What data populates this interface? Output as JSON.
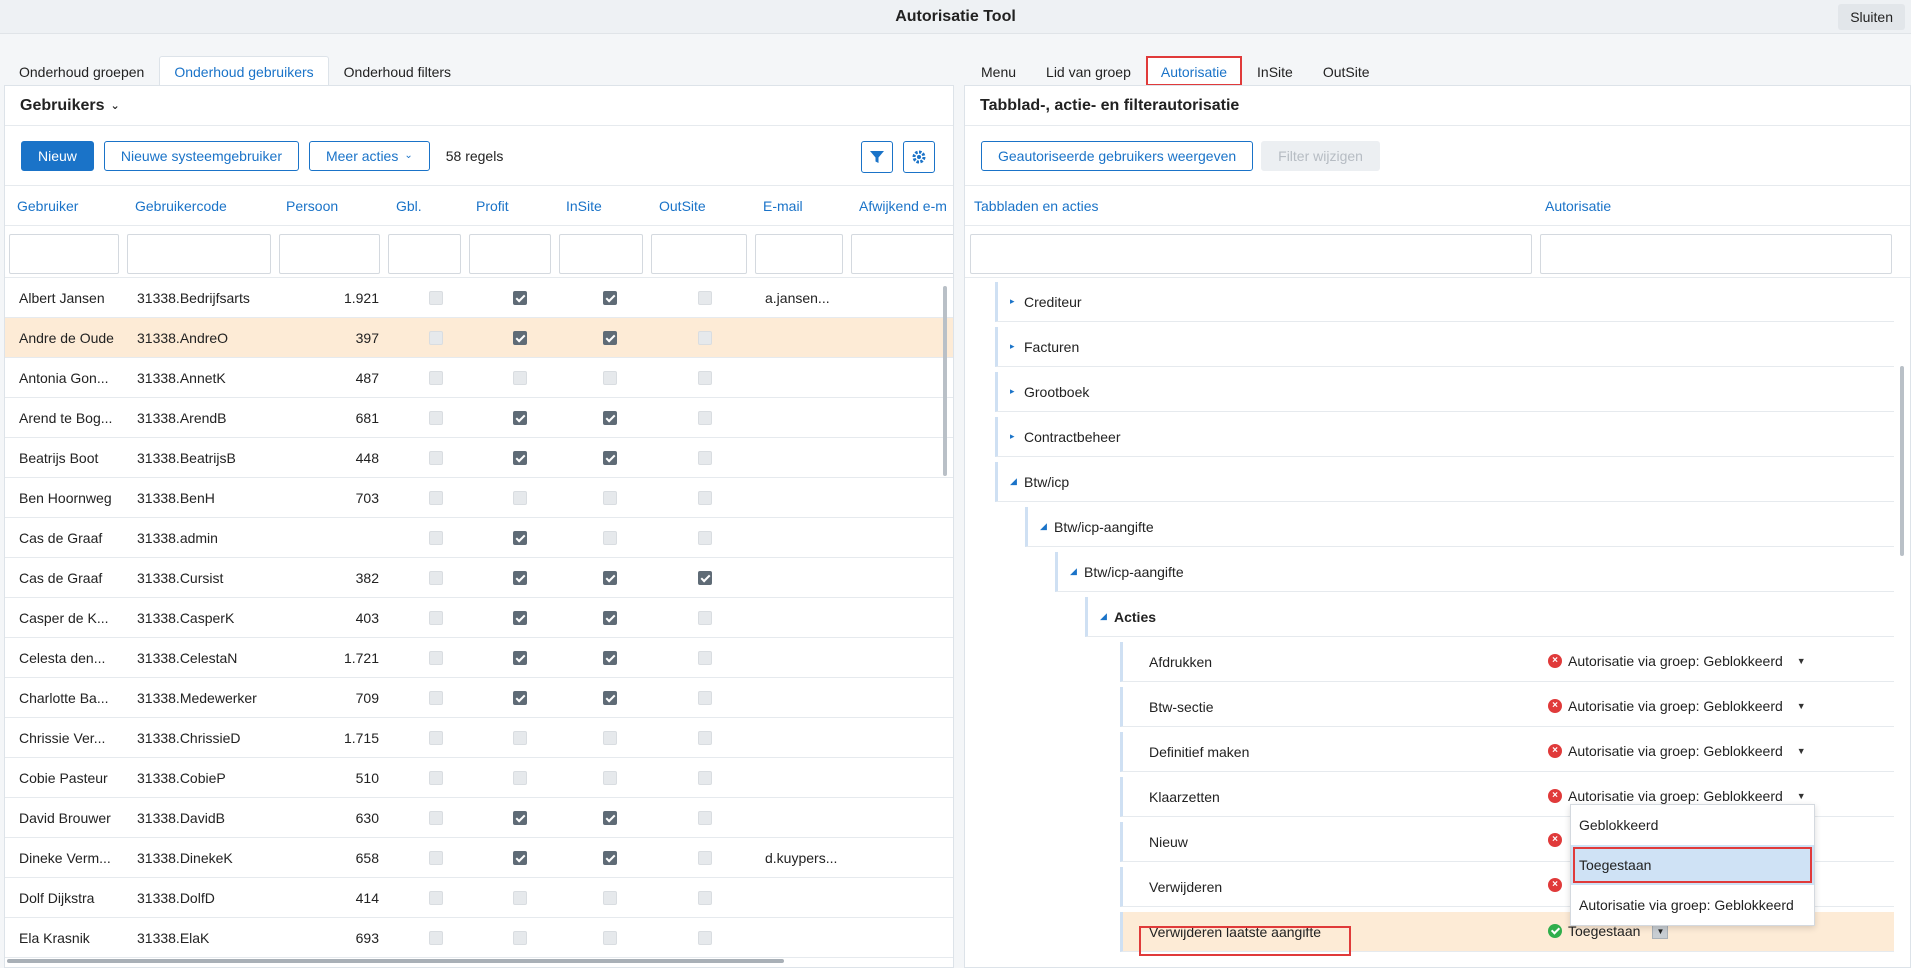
{
  "app": {
    "title": "Autorisatie Tool",
    "close_label": "Sluiten"
  },
  "left_tabs": [
    "Onderhoud groepen",
    "Onderhoud gebruikers",
    "Onderhoud filters"
  ],
  "right_tabs": [
    "Menu",
    "Lid van groep",
    "Autorisatie",
    "InSite",
    "OutSite"
  ],
  "left": {
    "heading": "Gebruikers",
    "btn_new": "Nieuw",
    "btn_system": "Nieuwe systeemgebruiker",
    "btn_more": "Meer acties",
    "count": "58 regels",
    "columns": [
      "Gebruiker",
      "Gebruikercode",
      "Persoon",
      "Gbl.",
      "Profit",
      "InSite",
      "OutSite",
      "E-mail",
      "Afwijkend e-m"
    ],
    "rows": [
      {
        "name": "Albert Jansen",
        "code": "31338.Bedrijfsarts",
        "persoon": "1.921",
        "gbl": false,
        "profit": true,
        "insite": true,
        "outsite": false,
        "email": "a.jansen..."
      },
      {
        "name": "Andre de Oude",
        "code": "31338.AndreO",
        "persoon": "397",
        "gbl": false,
        "profit": true,
        "insite": true,
        "outsite": false,
        "email": ""
      },
      {
        "name": "Antonia Gon...",
        "code": "31338.AnnetK",
        "persoon": "487",
        "gbl": false,
        "profit": false,
        "insite": false,
        "outsite": false,
        "email": ""
      },
      {
        "name": "Arend te Bog...",
        "code": "31338.ArendB",
        "persoon": "681",
        "gbl": false,
        "profit": true,
        "insite": true,
        "outsite": false,
        "email": ""
      },
      {
        "name": "Beatrijs Boot",
        "code": "31338.BeatrijsB",
        "persoon": "448",
        "gbl": false,
        "profit": true,
        "insite": true,
        "outsite": false,
        "email": ""
      },
      {
        "name": "Ben Hoornweg",
        "code": "31338.BenH",
        "persoon": "703",
        "gbl": false,
        "profit": false,
        "insite": false,
        "outsite": false,
        "email": ""
      },
      {
        "name": "Cas de Graaf",
        "code": "31338.admin",
        "persoon": "",
        "gbl": false,
        "profit": true,
        "insite": false,
        "outsite": false,
        "email": ""
      },
      {
        "name": "Cas de Graaf",
        "code": "31338.Cursist",
        "persoon": "382",
        "gbl": false,
        "profit": true,
        "insite": true,
        "outsite": true,
        "email": ""
      },
      {
        "name": "Casper de K...",
        "code": "31338.CasperK",
        "persoon": "403",
        "gbl": false,
        "profit": true,
        "insite": true,
        "outsite": false,
        "email": ""
      },
      {
        "name": "Celesta den...",
        "code": "31338.CelestaN",
        "persoon": "1.721",
        "gbl": false,
        "profit": true,
        "insite": true,
        "outsite": false,
        "email": ""
      },
      {
        "name": "Charlotte Ba...",
        "code": "31338.Medewerker",
        "persoon": "709",
        "gbl": false,
        "profit": true,
        "insite": true,
        "outsite": false,
        "email": ""
      },
      {
        "name": "Chrissie Ver...",
        "code": "31338.ChrissieD",
        "persoon": "1.715",
        "gbl": false,
        "profit": false,
        "insite": false,
        "outsite": false,
        "email": ""
      },
      {
        "name": "Cobie Pasteur",
        "code": "31338.CobieP",
        "persoon": "510",
        "gbl": false,
        "profit": false,
        "insite": false,
        "outsite": false,
        "email": ""
      },
      {
        "name": "David Brouwer",
        "code": "31338.DavidB",
        "persoon": "630",
        "gbl": false,
        "profit": true,
        "insite": true,
        "outsite": false,
        "email": ""
      },
      {
        "name": "Dineke Verm...",
        "code": "31338.DinekeK",
        "persoon": "658",
        "gbl": false,
        "profit": true,
        "insite": true,
        "outsite": false,
        "email": "d.kuypers..."
      },
      {
        "name": "Dolf Dijkstra",
        "code": "31338.DolfD",
        "persoon": "414",
        "gbl": false,
        "profit": false,
        "insite": false,
        "outsite": false,
        "email": ""
      },
      {
        "name": "Ela Krasnik",
        "code": "31338.ElaK",
        "persoon": "693",
        "gbl": false,
        "profit": false,
        "insite": false,
        "outsite": false,
        "email": ""
      }
    ]
  },
  "right": {
    "heading": "Tabblad-, actie- en filterautorisatie",
    "btn_show": "Geautoriseerde gebruikers weergeven",
    "btn_filter": "Filter wijzigen",
    "col_tabs": "Tabbladen en acties",
    "col_auth": "Autorisatie",
    "tree": [
      {
        "label": "Crediteur",
        "level": 0,
        "open": false
      },
      {
        "label": "Facturen",
        "level": 0,
        "open": false
      },
      {
        "label": "Grootboek",
        "level": 0,
        "open": false
      },
      {
        "label": "Contractbeheer",
        "level": 0,
        "open": false
      },
      {
        "label": "Btw/icp",
        "level": 0,
        "open": true
      },
      {
        "label": "Btw/icp-aangifte",
        "level": 1,
        "open": true
      },
      {
        "label": "Btw/icp-aangifte",
        "level": 2,
        "open": true
      },
      {
        "label": "Acties",
        "level": 3,
        "open": true,
        "bold": true
      }
    ],
    "actions": [
      {
        "label": "Afdrukken",
        "auth": "Autorisatie via groep: Geblokkeerd"
      },
      {
        "label": "Btw-sectie",
        "auth": "Autorisatie via groep: Geblokkeerd"
      },
      {
        "label": "Definitief maken",
        "auth": "Autorisatie via groep: Geblokkeerd"
      },
      {
        "label": "Klaarzetten",
        "auth": "Autorisatie via groep: Geblokkeerd"
      },
      {
        "label": "Nieuw",
        "auth": ""
      },
      {
        "label": "Verwijderen",
        "auth": ""
      },
      {
        "label": "Verwijderen laatste aangifte",
        "auth": "Toegestaan"
      }
    ],
    "dropdown": [
      "Geblokkeerd",
      "Toegestaan",
      "Autorisatie via groep: Geblokkeerd"
    ]
  },
  "colors": {
    "accent": "#1a73c8",
    "highlight": "#fdebd6",
    "red": "#e03a3a",
    "green": "#2fae4c"
  }
}
